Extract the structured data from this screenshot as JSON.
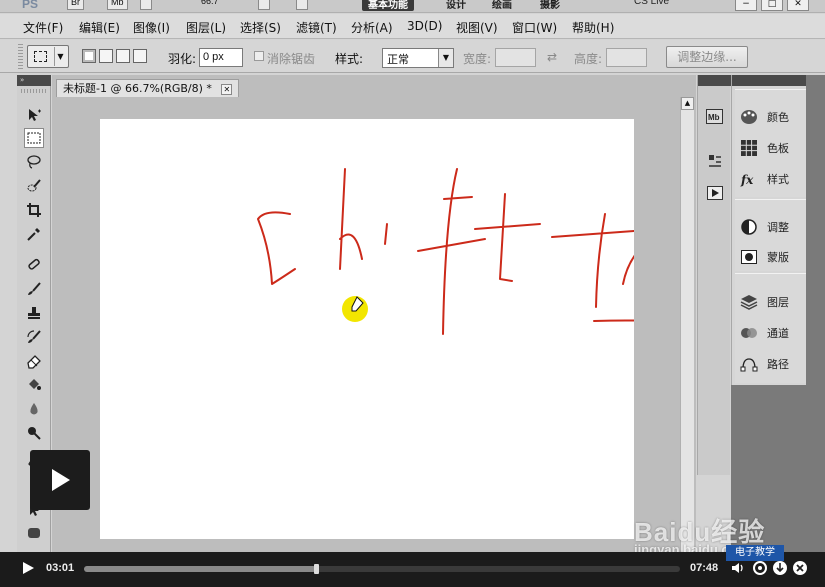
{
  "topbar": {
    "logo": "PS",
    "tb_br": "Br",
    "tb_mb": "Mb",
    "zoom": "66.7",
    "workspaces": [
      "基本功能",
      "设计",
      "绘画",
      "摄影"
    ],
    "cs_live": "CS Live"
  },
  "menu": {
    "items": [
      "文件(F)",
      "编辑(E)",
      "图像(I)",
      "图层(L)",
      "选择(S)",
      "滤镜(T)",
      "分析(A)",
      "3D(D)",
      "视图(V)",
      "窗口(W)",
      "帮助(H)"
    ]
  },
  "options": {
    "feather_label": "羽化:",
    "feather_value": "0 px",
    "antialias_label": "消除锯齿",
    "style_label": "样式:",
    "style_value": "正常",
    "width_label": "宽度:",
    "height_label": "高度:",
    "refine_label": "调整边缘..."
  },
  "document": {
    "tab_title": "未标题-1 @ 66.7%(RGB/8) *"
  },
  "panels": {
    "group1": [
      "颜色",
      "色板",
      "样式"
    ],
    "group2": [
      "调整",
      "蒙版"
    ],
    "group3": [
      "图层",
      "通道",
      "路径"
    ]
  },
  "player": {
    "current_time": "03:01",
    "total_time": "07:48",
    "progress": 0.39
  },
  "watermark": {
    "logo": "Baidu经验",
    "url": "jingyan.baidu.com",
    "badge": "电子教学"
  },
  "colors": {
    "stroke": "#cc2a1a",
    "cursor_highlight": "#f2e600",
    "badge_bg": "#1e56a8"
  }
}
